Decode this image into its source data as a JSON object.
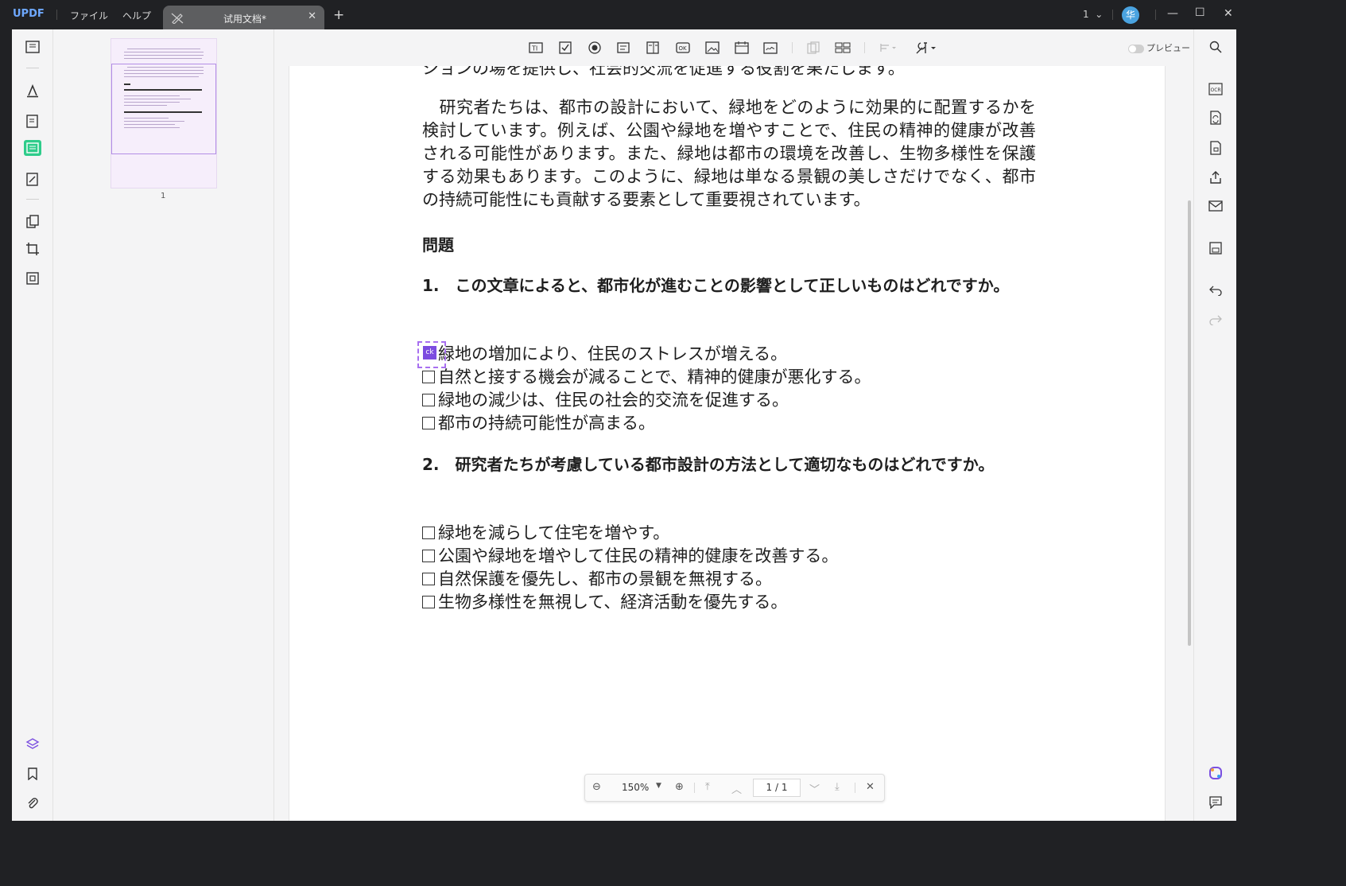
{
  "titlebar": {
    "logo": "UPDF",
    "menus": [
      "ファイル",
      "ヘルプ"
    ],
    "tab_title": "试用文档*",
    "page_selector": "1",
    "avatar_initial": "华"
  },
  "toolbar": {
    "preview_label": "プレビュー"
  },
  "thumbnail": {
    "page_label": "1"
  },
  "document": {
    "top_partial_line": "ションの場を提供し、社会的交流を促進する役割を果たします。",
    "paragraph": "　研究者たちは、都市の設計において、緑地をどのように効果的に配置するかを検討しています。例えば、公園や緑地を増やすことで、住民の精神的健康が改善される可能性があります。また、緑地は都市の環境を改善し、生物多様性を保護する効果もあります。このように、緑地は単なる景観の美しさだけでなく、都市の持続可能性にも貢献する要素として重要視されています。",
    "section_heading": "問題",
    "question1": "1.　この文章によると、都市化が進むことの影響として正しいものはどれですか。",
    "q1_options": [
      "緑地の増加により、住民のストレスが増える。",
      "自然と接する機会が減ることで、精神的健康が悪化する。",
      "緑地の減少は、住民の社会的交流を促進する。",
      "都市の持続可能性が高まる。"
    ],
    "question2": "2.　研究者たちが考慮している都市設計の方法として適切なものはどれですか。",
    "q2_options": [
      "緑地を減らして住宅を増やす。",
      "公園や緑地を増やして住民の精神的健康を改善する。",
      "自然保護を優先し、都市の景観を無視する。",
      "生物多様性を無視して、経済活動を優先する。"
    ],
    "selected_field_label": "ck"
  },
  "zoombar": {
    "zoom": "150%",
    "page_indicator": "1 / 1"
  }
}
